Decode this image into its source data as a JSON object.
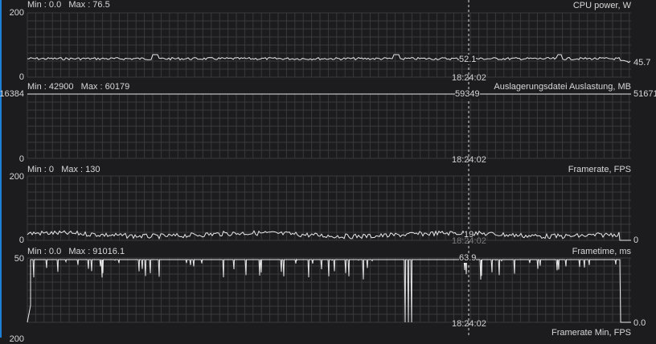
{
  "cursor_time": "18:24:02",
  "graphs": [
    {
      "title": "CPU power, W",
      "min": "Min : 0.0",
      "max": "Max : 76.5",
      "ymax": "200",
      "ymin": "0",
      "cursor_value": "52.1",
      "current_value": "45.7",
      "time": "18:24:02"
    },
    {
      "title": "Auslagerungsdatei Auslastung, MB",
      "min": "Min : 42900",
      "max": "Max : 60179",
      "ymax": "16384",
      "ymin": "0",
      "cursor_value": "59349",
      "current_value": "51671",
      "time": "18:24:02"
    },
    {
      "title": "Framerate, FPS",
      "min": "Min : 0",
      "max": "Max : 130",
      "ymax": "200",
      "ymin": "0",
      "cursor_value": "19",
      "current_value": "0",
      "time": "18:24:02"
    },
    {
      "title": "Frametime, ms",
      "min": "Min : 0.0",
      "max": "Max : 91016.1",
      "ymax": "50",
      "ymin": "0",
      "cursor_value": "63.9",
      "current_value": "0.0",
      "time": "18:24:02"
    },
    {
      "title": "Framerate Min, FPS",
      "ymax": "200"
    }
  ],
  "colors": {
    "background": "#1c1c1e",
    "grid": "#3a3a3c",
    "line": "#e8e8e8",
    "accent": "#1e7fd6"
  }
}
